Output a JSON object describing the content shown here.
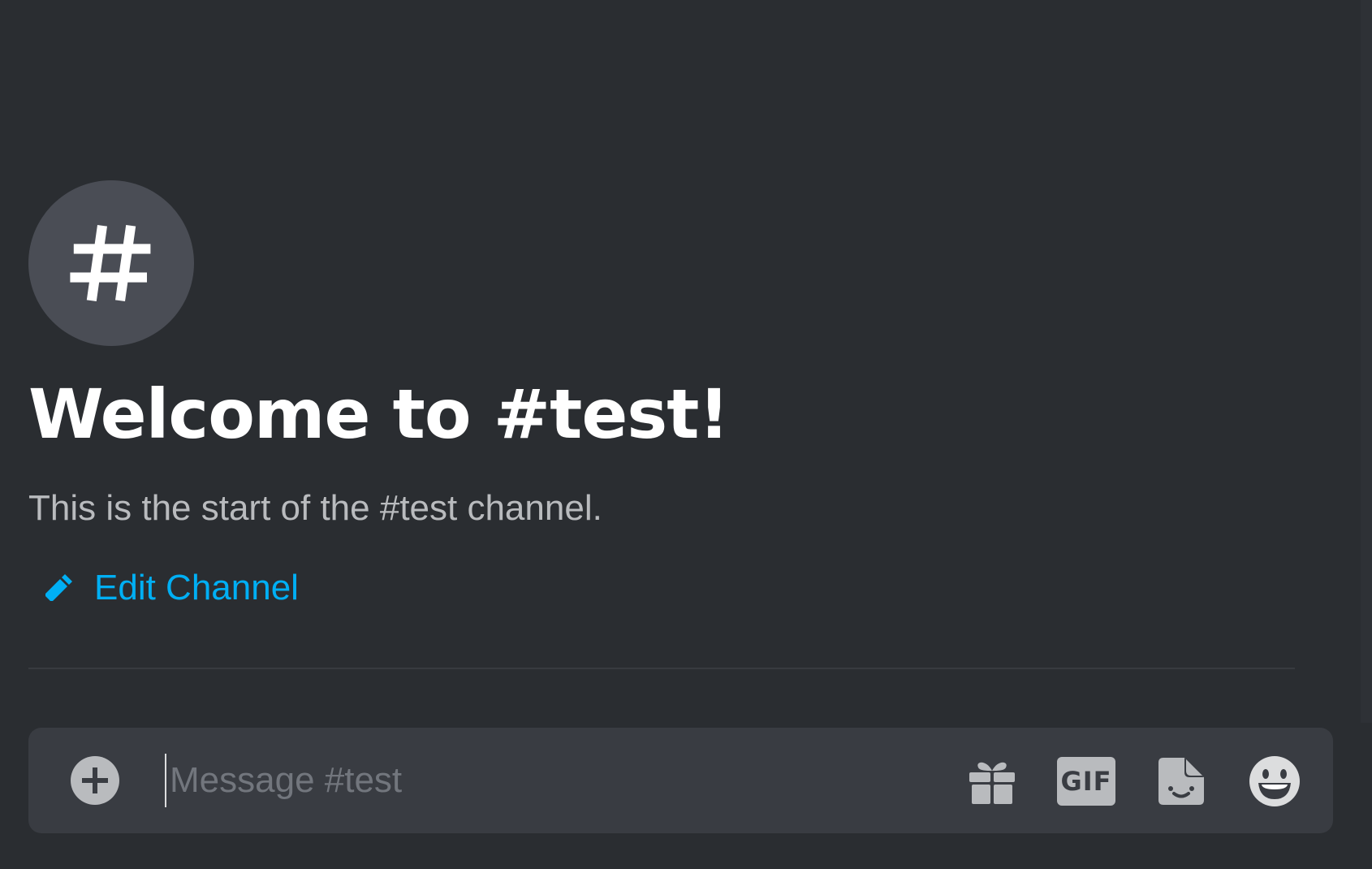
{
  "channel": {
    "name": "test",
    "avatar_icon": "hashtag-icon"
  },
  "welcome": {
    "title": "Welcome to #test!",
    "subtitle": "This is the start of the #test channel."
  },
  "edit_channel": {
    "label": "Edit Channel",
    "icon": "pencil-icon"
  },
  "composer": {
    "placeholder": "Message #test",
    "value": "",
    "upload_icon": "plus-circle-icon",
    "tools": [
      {
        "name": "gift",
        "icon": "gift-icon"
      },
      {
        "name": "gif",
        "icon": "gif-icon",
        "label": "GIF"
      },
      {
        "name": "sticker",
        "icon": "sticker-icon"
      },
      {
        "name": "emoji",
        "icon": "emoji-icon"
      }
    ]
  },
  "colors": {
    "background": "#2a2d31",
    "composer_background": "#393c42",
    "accent_link": "#00aff4",
    "title_text": "#ffffff",
    "muted_text": "#b9bbbe",
    "icon_gray": "#b9bbbe",
    "avatar_background": "#4a4d55"
  }
}
